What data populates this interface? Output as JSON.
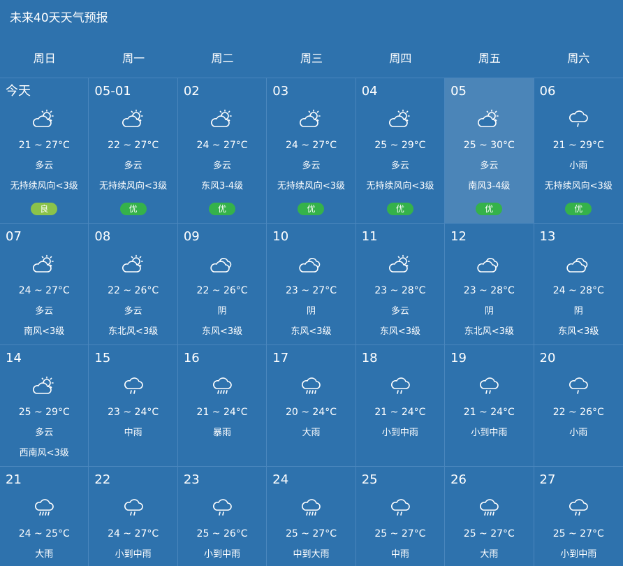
{
  "page": {
    "title": "未来40天天气预报"
  },
  "weekdays": [
    "周日",
    "周一",
    "周二",
    "周三",
    "周四",
    "周五",
    "周六"
  ],
  "colors": {
    "background": "#2e72ad",
    "aqi_good": "#8bc34a",
    "aqi_excellent": "#35b24a"
  },
  "rows": [
    [
      {
        "date": "今天",
        "icon": "partly-cloudy-icon",
        "temp": "21 ~ 27°C",
        "cond": "多云",
        "wind": "无持续风向<3级",
        "aqi": "良",
        "aqi_level": "good"
      },
      {
        "date": "05-01",
        "icon": "partly-cloudy-icon",
        "temp": "22 ~ 27°C",
        "cond": "多云",
        "wind": "无持续风向<3级",
        "aqi": "优",
        "aqi_level": "excellent"
      },
      {
        "date": "02",
        "icon": "partly-cloudy-icon",
        "temp": "24 ~ 27°C",
        "cond": "多云",
        "wind": "东风3-4级",
        "aqi": "优",
        "aqi_level": "excellent"
      },
      {
        "date": "03",
        "icon": "partly-cloudy-icon",
        "temp": "24 ~ 27°C",
        "cond": "多云",
        "wind": "无持续风向<3级",
        "aqi": "优",
        "aqi_level": "excellent"
      },
      {
        "date": "04",
        "icon": "partly-cloudy-icon",
        "temp": "25 ~ 29°C",
        "cond": "多云",
        "wind": "无持续风向<3级",
        "aqi": "优",
        "aqi_level": "excellent"
      },
      {
        "date": "05",
        "icon": "partly-cloudy-icon",
        "temp": "25 ~ 30°C",
        "cond": "多云",
        "wind": "南风3-4级",
        "aqi": "优",
        "aqi_level": "excellent",
        "highlight": true
      },
      {
        "date": "06",
        "icon": "light-rain-icon",
        "temp": "21 ~ 29°C",
        "cond": "小雨",
        "wind": "无持续风向<3级",
        "aqi": "优",
        "aqi_level": "excellent"
      }
    ],
    [
      {
        "date": "07",
        "icon": "partly-cloudy-icon",
        "temp": "24 ~ 27°C",
        "cond": "多云",
        "wind": "南风<3级"
      },
      {
        "date": "08",
        "icon": "partly-cloudy-icon",
        "temp": "22 ~ 26°C",
        "cond": "多云",
        "wind": "东北风<3级"
      },
      {
        "date": "09",
        "icon": "overcast-icon",
        "temp": "22 ~ 26°C",
        "cond": "阴",
        "wind": "东风<3级"
      },
      {
        "date": "10",
        "icon": "overcast-icon",
        "temp": "23 ~ 27°C",
        "cond": "阴",
        "wind": "东风<3级"
      },
      {
        "date": "11",
        "icon": "partly-cloudy-icon",
        "temp": "23 ~ 28°C",
        "cond": "多云",
        "wind": "东风<3级"
      },
      {
        "date": "12",
        "icon": "overcast-icon",
        "temp": "23 ~ 28°C",
        "cond": "阴",
        "wind": "东北风<3级"
      },
      {
        "date": "13",
        "icon": "overcast-icon",
        "temp": "24 ~ 28°C",
        "cond": "阴",
        "wind": "东风<3级"
      }
    ],
    [
      {
        "date": "14",
        "icon": "partly-cloudy-icon",
        "temp": "25 ~ 29°C",
        "cond": "多云",
        "wind": "西南风<3级"
      },
      {
        "date": "15",
        "icon": "moderate-rain-icon",
        "temp": "23 ~ 24°C",
        "cond": "中雨",
        "wind": ""
      },
      {
        "date": "16",
        "icon": "heavy-rain-icon",
        "temp": "21 ~ 24°C",
        "cond": "暴雨",
        "wind": ""
      },
      {
        "date": "17",
        "icon": "heavy-rain-icon",
        "temp": "20 ~ 24°C",
        "cond": "大雨",
        "wind": ""
      },
      {
        "date": "18",
        "icon": "moderate-rain-icon",
        "temp": "21 ~ 24°C",
        "cond": "小到中雨",
        "wind": ""
      },
      {
        "date": "19",
        "icon": "moderate-rain-icon",
        "temp": "21 ~ 24°C",
        "cond": "小到中雨",
        "wind": ""
      },
      {
        "date": "20",
        "icon": "light-rain-icon",
        "temp": "22 ~ 26°C",
        "cond": "小雨",
        "wind": ""
      }
    ],
    [
      {
        "date": "21",
        "icon": "heavy-rain-icon",
        "temp": "24 ~ 25°C",
        "cond": "大雨",
        "wind": ""
      },
      {
        "date": "22",
        "icon": "moderate-rain-icon",
        "temp": "24 ~ 27°C",
        "cond": "小到中雨",
        "wind": ""
      },
      {
        "date": "23",
        "icon": "moderate-rain-icon",
        "temp": "25 ~ 26°C",
        "cond": "小到中雨",
        "wind": ""
      },
      {
        "date": "24",
        "icon": "heavy-rain-icon",
        "temp": "25 ~ 27°C",
        "cond": "中到大雨",
        "wind": ""
      },
      {
        "date": "25",
        "icon": "moderate-rain-icon",
        "temp": "25 ~ 27°C",
        "cond": "中雨",
        "wind": ""
      },
      {
        "date": "26",
        "icon": "heavy-rain-icon",
        "temp": "25 ~ 27°C",
        "cond": "大雨",
        "wind": ""
      },
      {
        "date": "27",
        "icon": "moderate-rain-icon",
        "temp": "25 ~ 27°C",
        "cond": "小到中雨",
        "wind": ""
      }
    ]
  ]
}
